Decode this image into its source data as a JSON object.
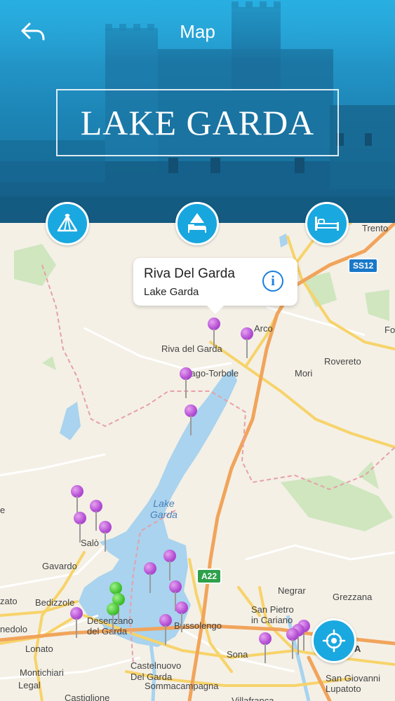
{
  "header": {
    "title": "Map",
    "banner_title": "LAKE GARDA",
    "back_icon": "back-arrow-icon"
  },
  "categories": [
    {
      "name": "camping",
      "icon": "tent-icon",
      "selected": false
    },
    {
      "name": "hotel",
      "icon": "tent-bed-icon",
      "selected": true
    },
    {
      "name": "lodging",
      "icon": "bed-icon",
      "selected": false
    }
  ],
  "callout": {
    "title": "Riva Del Garda",
    "subtitle": "Lake Garda",
    "info_icon": "i"
  },
  "map": {
    "lake_label": "Lake\nGarda",
    "labels": {
      "trento": "Trento",
      "arco": "Arco",
      "riva": "Riva del Garda",
      "torbole": "Nago-Torbole",
      "mori": "Mori",
      "rovereto": "Rovereto",
      "fo": "Fo",
      "salo": "Salò",
      "gavardo": "Gavardo",
      "zato": "zato",
      "bedizzole": "Bedizzole",
      "desenzano": "Desenzano\ndel Garda",
      "nedolo": "nedolo",
      "lonato": "Lonato",
      "montichiari": "Montichiari",
      "legal": "Legal",
      "castiglione": "Castiglione",
      "negrar": "Negrar",
      "grezzana": "Grezzana",
      "sanpietro": "San Pietro\nin Cariano",
      "bussolengo": "Bussolengo",
      "sona": "Sona",
      "castelnuovo": "Castelnuovo\nDel Garda",
      "sommacampagna": "Sommacampagna",
      "villafranca": "Villafranca",
      "sangiovanni": "San Giovanni\nLupatoto",
      "verona_fragment": "A",
      "e_fragment": "e"
    },
    "shields": {
      "ss12": "SS12",
      "a22": "A22"
    }
  },
  "locate_button": {
    "icon": "location-crosshair-icon"
  },
  "colors": {
    "accent": "#1aa8e0",
    "pin_purple": "#b24bd3",
    "pin_green": "#42c22e",
    "lake": "#a9d3ee",
    "land": "#f4f0e6",
    "road_yellow": "#f7d36a"
  }
}
